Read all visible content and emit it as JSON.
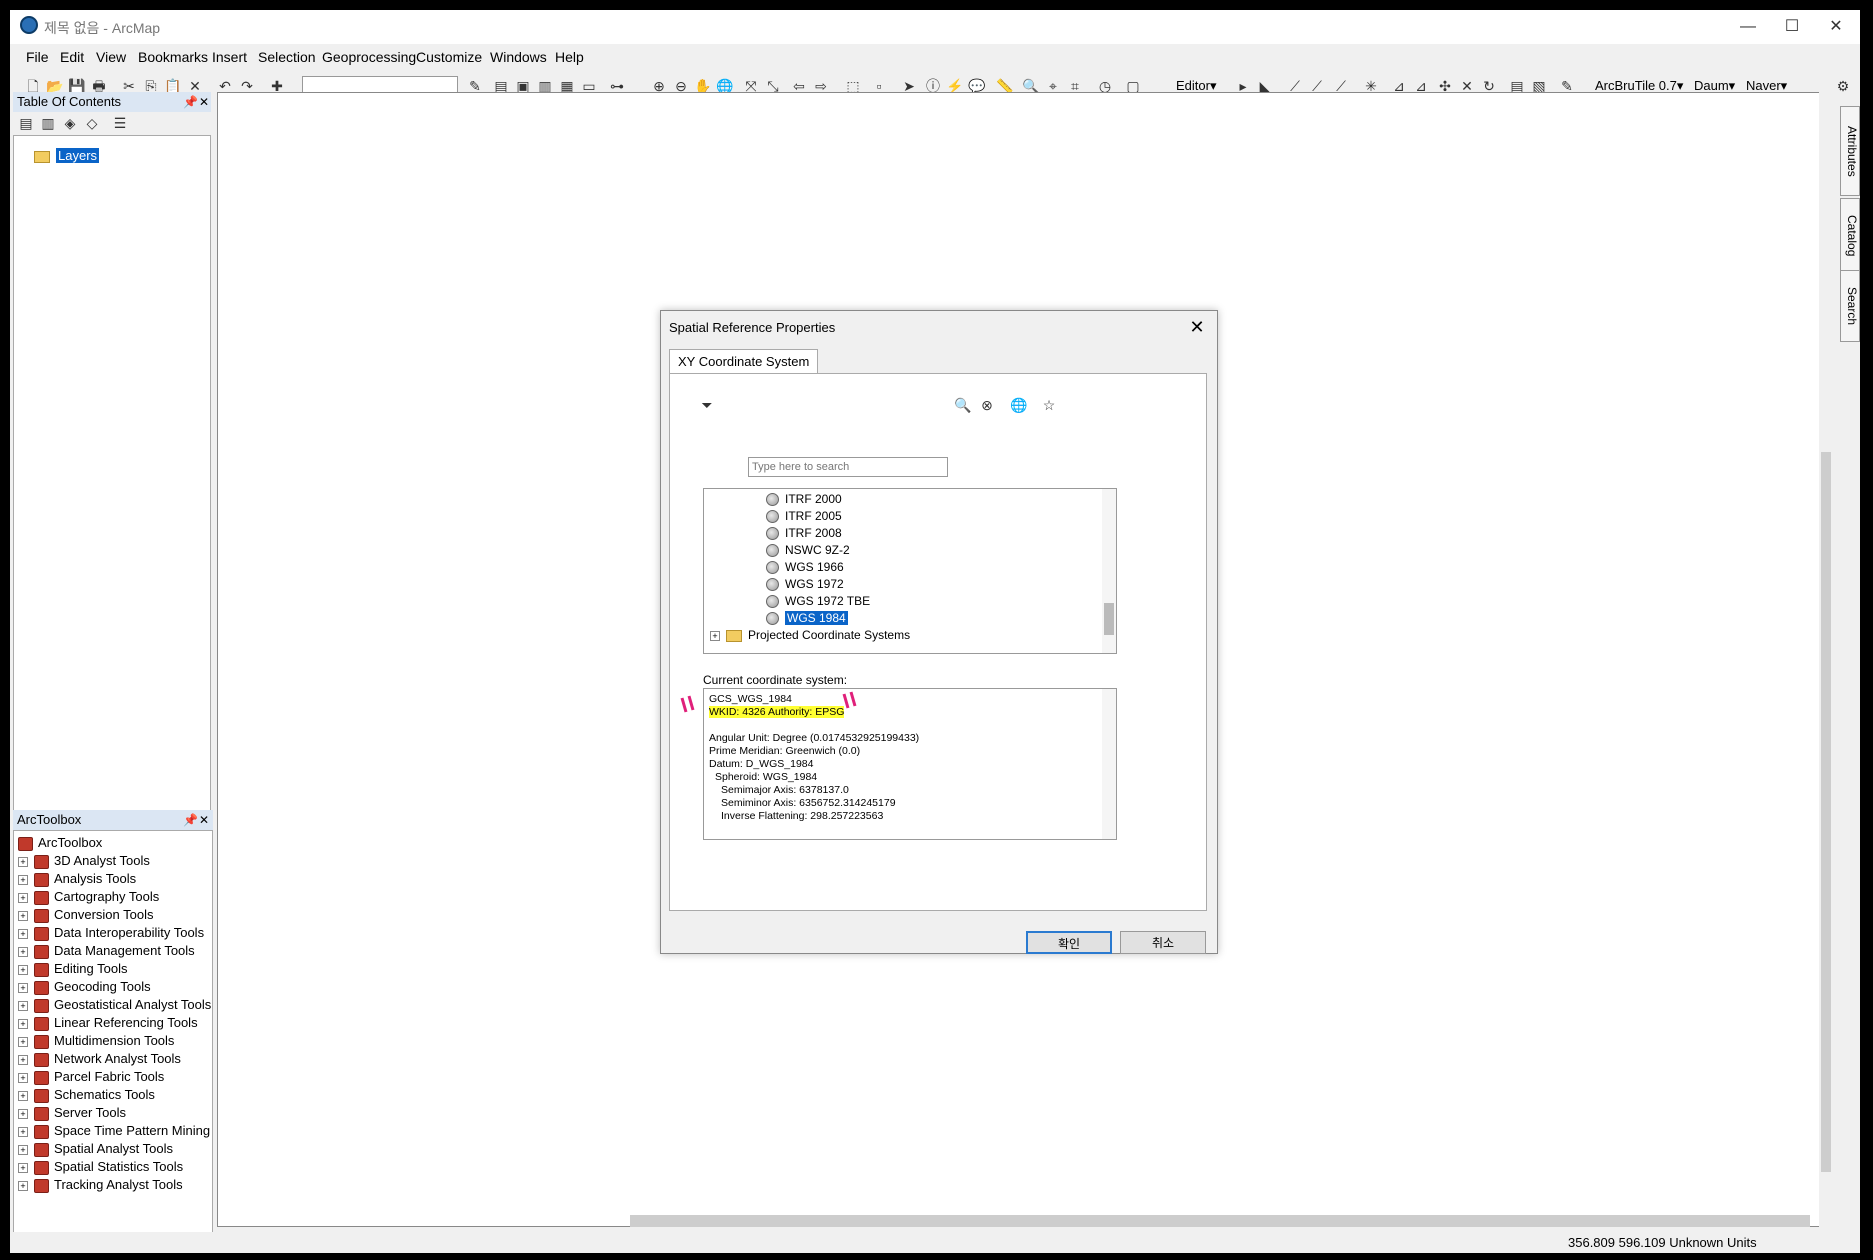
{
  "window": {
    "title": "제목 없음 - ArcMap",
    "min": "—",
    "max": "☐",
    "close": "✕"
  },
  "menu": [
    "File",
    "Edit",
    "View",
    "Bookmarks",
    "Insert",
    "Selection",
    "Geoprocessing",
    "Customize",
    "Windows",
    "Help"
  ],
  "toolbar": {
    "editor": "Editor▾",
    "arcbrutile": "ArcBruTile 0.7▾",
    "daum": "Daum▾",
    "naver": "Naver▾"
  },
  "toc": {
    "title": "Table Of Contents",
    "layers": "Layers"
  },
  "toolbox": {
    "title": "ArcToolbox",
    "root": "ArcToolbox",
    "items": [
      "3D Analyst Tools",
      "Analysis Tools",
      "Cartography Tools",
      "Conversion Tools",
      "Data Interoperability Tools",
      "Data Management Tools",
      "Editing Tools",
      "Geocoding Tools",
      "Geostatistical Analyst Tools",
      "Linear Referencing Tools",
      "Multidimension Tools",
      "Network Analyst Tools",
      "Parcel Fabric Tools",
      "Schematics Tools",
      "Server Tools",
      "Space Time Pattern Mining T",
      "Spatial Analyst Tools",
      "Spatial Statistics Tools",
      "Tracking Analyst Tools"
    ]
  },
  "side_tabs": [
    "Attributes",
    "Catalog",
    "Search"
  ],
  "dialog": {
    "title": "Spatial Reference Properties",
    "tab": "XY Coordinate System",
    "search_placeholder": "Type here to search",
    "tree": [
      "ITRF 2000",
      "ITRF 2005",
      "ITRF 2008",
      "NSWC 9Z-2",
      "WGS 1966",
      "WGS 1972",
      "WGS 1972 TBE",
      "WGS 1984"
    ],
    "selected": "WGS 1984",
    "projected": "Projected Coordinate Systems",
    "current_label": "Current coordinate system:",
    "current": {
      "name": "GCS_WGS_1984",
      "wkid": "WKID: 4326 Authority: EPSG",
      "angular": "Angular Unit: Degree (0.0174532925199433)",
      "meridian": "Prime Meridian: Greenwich (0.0)",
      "datum": "Datum: D_WGS_1984",
      "spheroid": "Spheroid: WGS_1984",
      "semimajor": "Semimajor Axis: 6378137.0",
      "semiminor": "Semiminor Axis: 6356752.314245179",
      "flattening": "Inverse Flattening: 298.257223563"
    },
    "ok": "확인",
    "cancel": "취소"
  },
  "status": "356.809  596.109 Unknown Units"
}
